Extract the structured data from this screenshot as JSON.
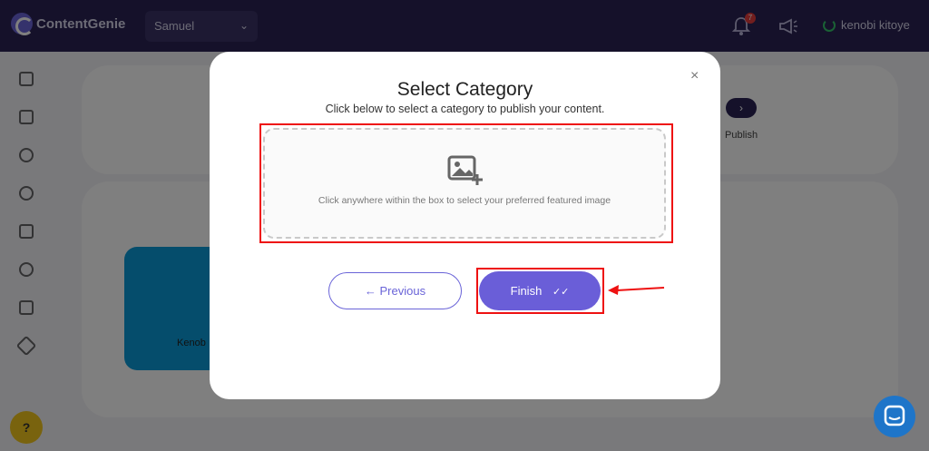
{
  "app": {
    "logo_text": "ContentGenie",
    "workspace_select": "Samuel",
    "notification_count": "7",
    "user_name": "kenobi kitoye"
  },
  "background": {
    "next_arrow": "›",
    "publish_label": "Publish",
    "profile_name": "Kenob"
  },
  "modal": {
    "title": "Select Category",
    "subtitle": "Click below to select a category to publish your content.",
    "upload_hint": "Click anywhere within the box to select your preferred featured image",
    "close_label": "×",
    "previous_label": "← Previous",
    "finish_label": "Finish"
  },
  "help_label": "?",
  "colors": {
    "accent": "#6a5ed8",
    "topbar": "#2a2354",
    "highlight": "#ee1111"
  }
}
